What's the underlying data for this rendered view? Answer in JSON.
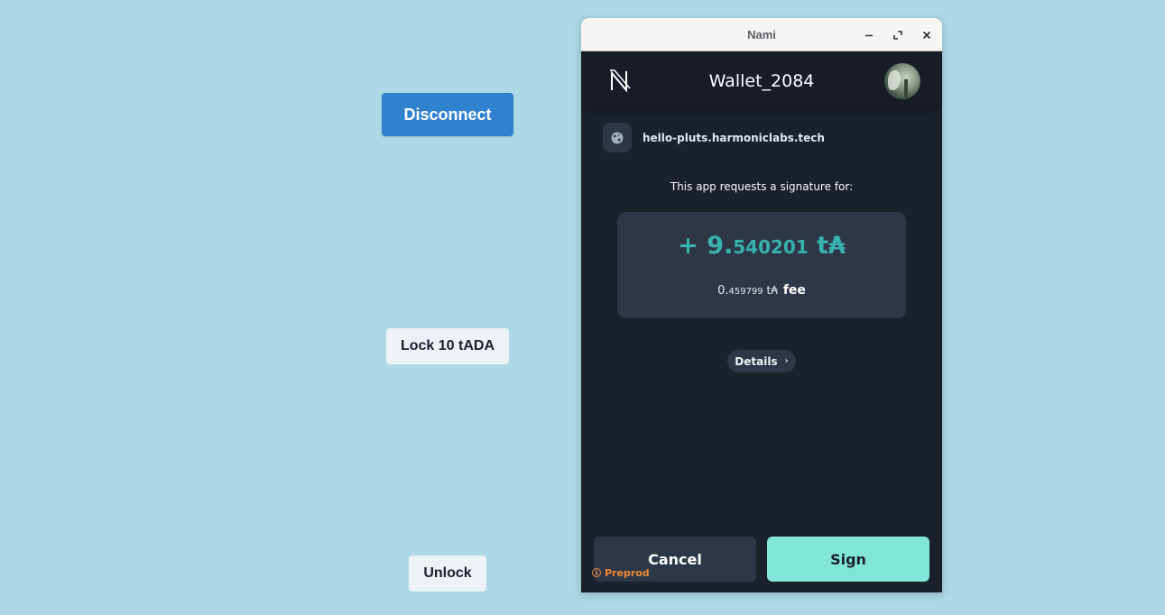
{
  "page": {
    "disconnect_label": "Disconnect",
    "lock_label": "Lock 10 tADA",
    "unlock_label": "Unlock"
  },
  "window": {
    "title": "Nami"
  },
  "header": {
    "wallet_name": "Wallet_2084",
    "logo_icon": "nami-logo-icon",
    "avatar_icon": "avatar"
  },
  "request": {
    "origin": "hello-pluts.harmoniclabs.tech",
    "message": "This app requests a signature for:",
    "amount_sign": "+ ",
    "amount_int": "9.",
    "amount_dec": "540201",
    "amount_unit": " t₳",
    "fee_int": "0.",
    "fee_dec": "459799",
    "fee_unit": " t₳",
    "fee_label": "fee",
    "details_label": "Details"
  },
  "actions": {
    "cancel_label": "Cancel",
    "sign_label": "Sign"
  },
  "network": {
    "label": "Preprod"
  },
  "colors": {
    "background": "#add8e6",
    "accent": "#38b2ac",
    "sign_button": "#81e6d9",
    "disconnect_button": "#3182ce",
    "network": "#ed8936"
  }
}
